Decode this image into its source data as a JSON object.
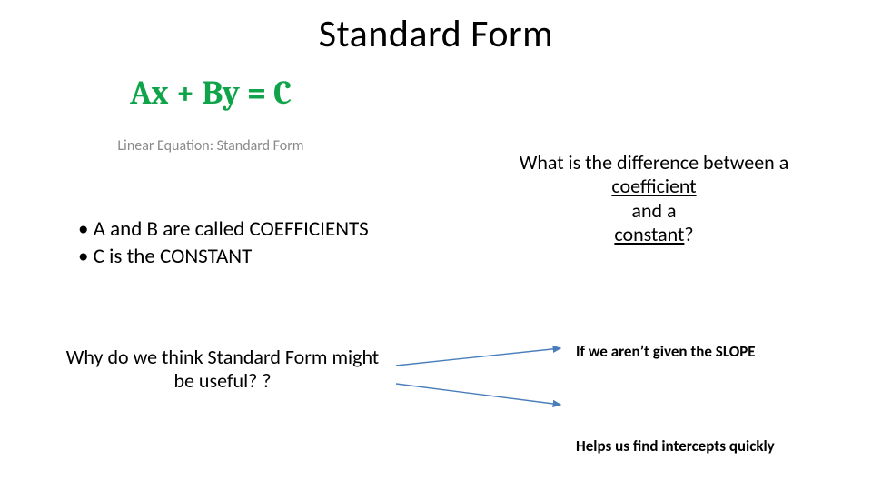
{
  "title": "Standard Form",
  "equation": {
    "lhs_a": "Ax",
    "plus": " + ",
    "lhs_b": "By",
    "eq": " = ",
    "rhs": "C",
    "caption": "Linear Equation: Standard Form"
  },
  "bullets": {
    "line1": "• A and B are called COEFFICIENTS",
    "line2": "• C is the CONSTANT"
  },
  "question": {
    "line1": "What is the difference between a",
    "coef": "coefficient",
    "and": "and a",
    "const": "constant",
    "qmark": "?"
  },
  "why": {
    "line1": "Why do we think Standard Form might",
    "line2": "be useful? ?"
  },
  "answers": {
    "a1": "If we aren’t given the SLOPE",
    "a2": "Helps us find intercepts quickly"
  },
  "colors": {
    "equation_green": "#10A44A",
    "caption_gray": "#8A8A8A",
    "arrow_blue": "#4A7EBB"
  }
}
